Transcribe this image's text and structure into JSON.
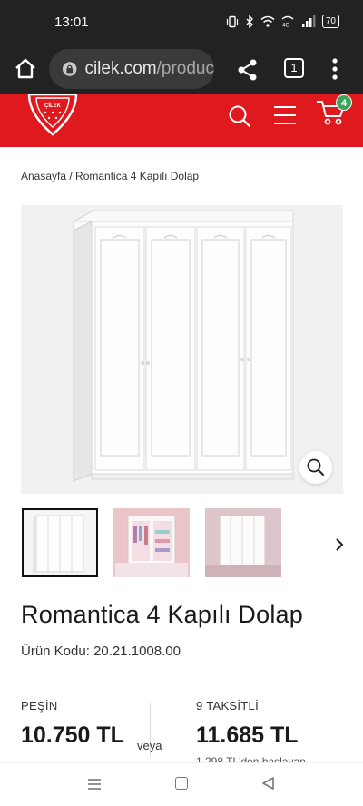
{
  "status_bar": {
    "time": "13:01",
    "battery": "70",
    "icons": [
      "vibrate-icon",
      "bluetooth-icon",
      "wifi-icon",
      "volte-icon",
      "signal-icon",
      "battery-icon"
    ]
  },
  "browser": {
    "url_domain": "cilek.com",
    "url_path": "/produc",
    "tab_count": "1"
  },
  "site": {
    "brand_color": "#e0191f",
    "logo_text": "ÇİLEK",
    "cart_count": "4",
    "cart_badge_color": "#3ba35a"
  },
  "breadcrumb": "Anasayfa / Romantica 4 Kapılı Dolap",
  "product": {
    "title": "Romantica 4 Kapılı Dolap",
    "code": "Ürün Kodu: 20.21.1008.00"
  },
  "pricing": {
    "cash_label": "PEŞİN",
    "cash_price": "10.750 TL",
    "or_label": "veya",
    "installment_label": "9 TAKSİTLİ",
    "installment_price": "11.685 TL",
    "installment_note": "1.298 TL'den başlayan"
  }
}
